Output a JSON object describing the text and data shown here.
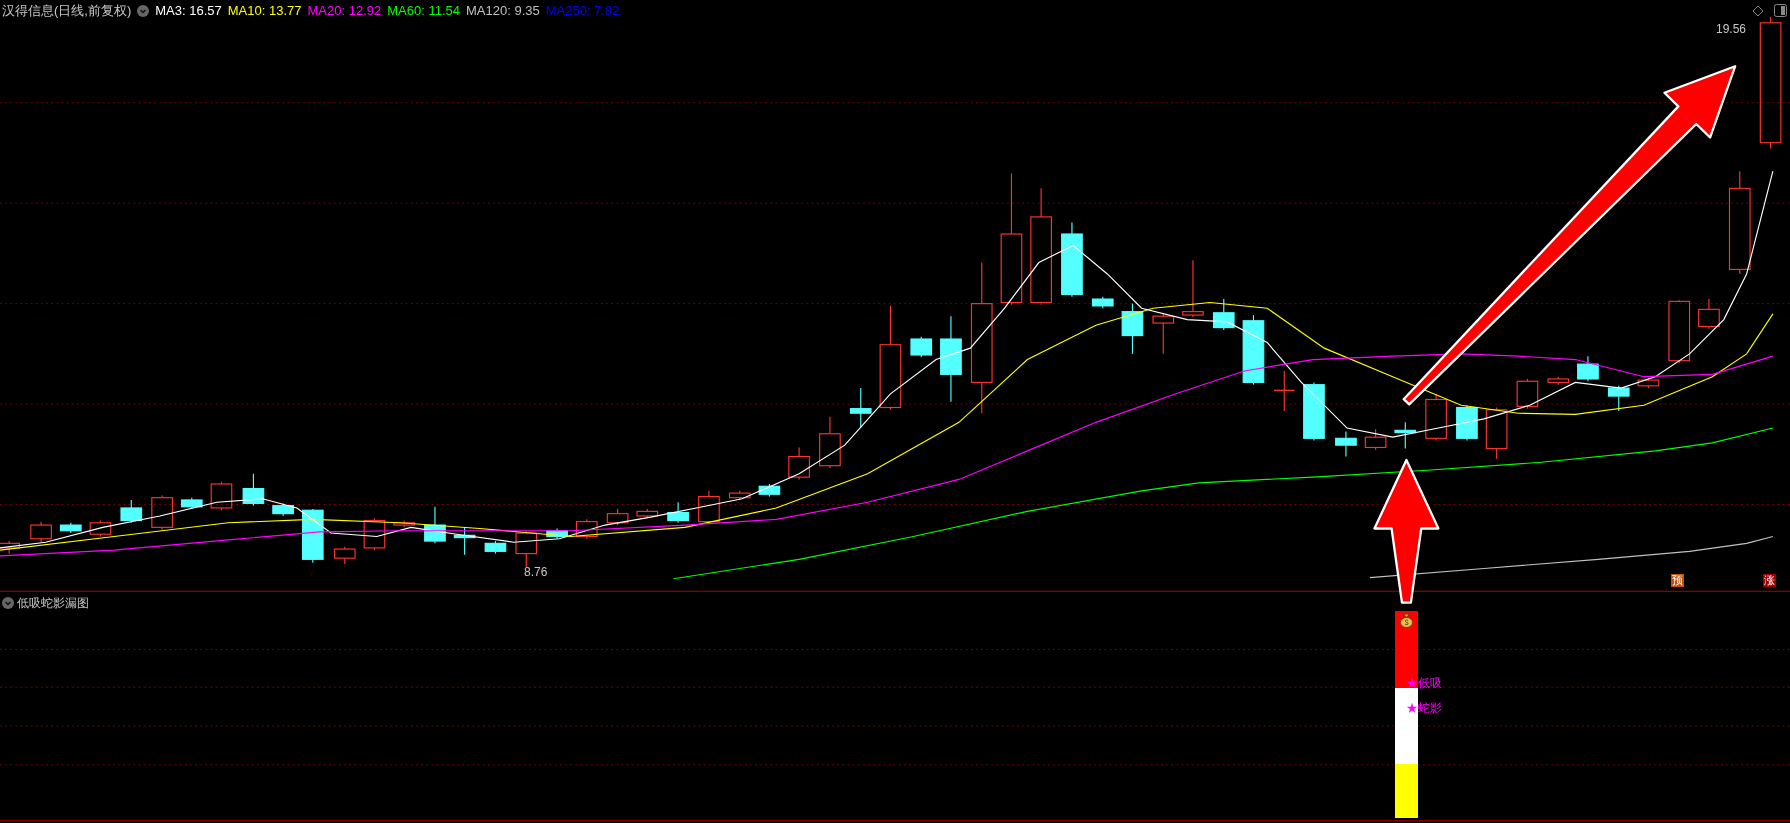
{
  "main_chart": {
    "title": "汉得信息(日线,前复权)",
    "ma_legend": [
      {
        "label": "MA3: 16.57",
        "color": "#ffffff"
      },
      {
        "label": "MA10: 13.77",
        "color": "#ffff00"
      },
      {
        "label": "MA20: 12.92",
        "color": "#ff00ff"
      },
      {
        "label": "MA60: 11.54",
        "color": "#00ff00"
      },
      {
        "label": "MA120: 9.35",
        "color": "#c0c0c0"
      },
      {
        "label": "MA250: 7.82",
        "color": "#0000ff"
      }
    ],
    "high_label": "19.56",
    "low_label": "8.76",
    "badges": [
      {
        "text": "预",
        "color": "#c0500a"
      },
      {
        "text": "涨",
        "color": "#a00000"
      }
    ]
  },
  "indicator_panel": {
    "title": "低吸蛇影漏图",
    "signals": [
      "★低吸",
      "★蛇影"
    ]
  }
}
